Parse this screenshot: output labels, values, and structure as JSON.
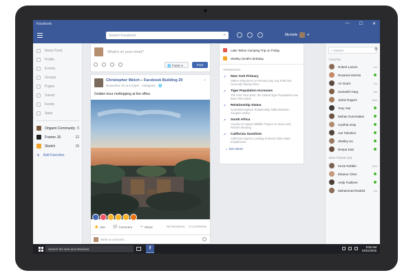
{
  "window": {
    "title": "Facebook",
    "controls": [
      "—",
      "☐",
      "✕"
    ]
  },
  "header": {
    "search_placeholder": "Search Facebook",
    "user_name": "Michelle"
  },
  "left_nav": {
    "items": [
      {
        "label": "News Feed",
        "icon": "newsfeed-icon"
      },
      {
        "label": "Profile",
        "icon": "profile-icon"
      },
      {
        "label": "Events",
        "icon": "events-icon"
      },
      {
        "label": "Groups",
        "icon": "groups-icon"
      },
      {
        "label": "Pages",
        "icon": "pages-icon"
      },
      {
        "label": "Saved",
        "icon": "saved-icon"
      },
      {
        "label": "Feeds",
        "icon": "feeds-icon"
      },
      {
        "label": "Apps",
        "icon": "apps-icon"
      }
    ],
    "favorites": [
      {
        "label": "Origami Community",
        "count": "5",
        "color": "#7a5a3c"
      },
      {
        "label": "Framer JS",
        "count": "12",
        "color": "#222222"
      },
      {
        "label": "Sketch",
        "count": "15",
        "color": "#f0a32b"
      }
    ],
    "add_favorites": "Add Favorites"
  },
  "composer": {
    "placeholder": "What's on your mind?",
    "audience": "Public",
    "post_label": "Post"
  },
  "post": {
    "author": "Christopher Welch",
    "arrow": "▸",
    "group": "Facebook Building 20",
    "meta": "November 20 at 6:42pm · Instagram · 🌐",
    "text": "Golden hour rooftopping at the office.",
    "actions": {
      "like": "Like",
      "comment": "Comment",
      "share": "Share"
    },
    "reactions_count": "50 Reactions",
    "comments_count": "5 Comments",
    "write_comment": "Write a comment..."
  },
  "ticker": {
    "events": [
      {
        "label": "Lake Tahoe Camping Trip on Friday",
        "color": "#e4574a"
      },
      {
        "label": "Shelley Smith's birthday",
        "color": "#f5a623"
      }
    ],
    "trending_header": "TRENDING",
    "trends": [
      {
        "title": "New York Primary",
        "desc": "State's Reporters on Primary Day Say Polls Not Currently Taking Place"
      },
      {
        "title": "Tiger Population Increases",
        "desc": "The First Time Ever, the Global Tiger Population Has Been Recorded"
      },
      {
        "title": "Relationship Status",
        "desc": "Scientists Explore Relationship Talks Between Couples Online"
      },
      {
        "title": "South Africa",
        "desc": "Country to Impact Wildlife Project on Zulu Land Reform Meeting"
      },
      {
        "title": "California Sunshine",
        "desc": "California Agency Looking to Boost Solar State Installments"
      }
    ],
    "see_more": "See More"
  },
  "chat": {
    "search_placeholder": "Search",
    "favorites_header": "Favorites",
    "favorites": [
      {
        "name": "Robert Larson",
        "status": "1m"
      },
      {
        "name": "Roxanne Dennis",
        "status": "online"
      },
      {
        "name": "Ari Grant",
        "status": "2m"
      },
      {
        "name": "Sumanth Garg",
        "status": "5m"
      },
      {
        "name": "Jamie Rogers",
        "status": "18m"
      },
      {
        "name": "Tony Yan",
        "status": "online"
      },
      {
        "name": "Mohan Gummalam",
        "status": "online"
      },
      {
        "name": "Cynthia Gray",
        "status": "online"
      },
      {
        "name": "Joe Tolentino",
        "status": "online"
      },
      {
        "name": "Shelley Ho",
        "status": "online"
      },
      {
        "name": "Deepa Sasi",
        "status": "online"
      }
    ],
    "more_header": "More Friends (16)",
    "more": [
      {
        "name": "Kevin Robbie",
        "status": "19m"
      },
      {
        "name": "Eleanor Chen",
        "status": "online"
      },
      {
        "name": "Andy Faulkner",
        "status": "online"
      },
      {
        "name": "Mohammed Rashid",
        "status": "1m"
      }
    ]
  },
  "taskbar": {
    "search_placeholder": "Search the web and Windows",
    "time": "9:06 AM",
    "date": "04/21/2016"
  },
  "colors": {
    "brand": "#3b5998",
    "online": "#42b72a",
    "link": "#365899"
  }
}
